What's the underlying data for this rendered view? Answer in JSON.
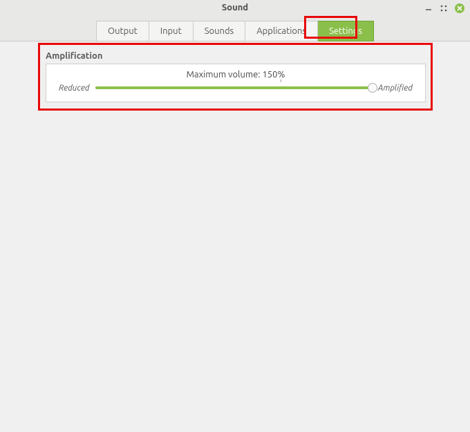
{
  "window": {
    "title": "Sound"
  },
  "tabs": {
    "output": {
      "label": "Output"
    },
    "input": {
      "label": "Input"
    },
    "sounds": {
      "label": "Sounds"
    },
    "applications": {
      "label": "Applications"
    },
    "settings": {
      "label": "Settings",
      "active": true
    }
  },
  "section": {
    "title": "Amplification",
    "max_volume_label": "Maximum volume: 150%",
    "max_volume_percent": 150,
    "reduced_label": "Reduced",
    "amplified_label": "Amplified"
  },
  "colors": {
    "accent": "#8bbf4b",
    "highlight": "#e80808"
  }
}
